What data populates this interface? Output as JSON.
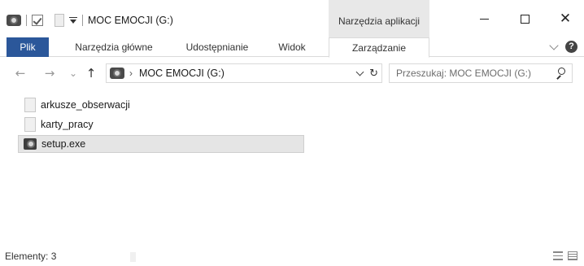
{
  "titlebar": {
    "title": "MOC EMOCJI (G:)",
    "context_tab_header": "Narzędzia aplikacji",
    "icons": [
      "drive-icon",
      "properties-check-icon",
      "new-folder-icon",
      "customize-dropdown-icon",
      "minimize-icon",
      "maximize-icon",
      "close-icon"
    ],
    "close_glyph": "✕"
  },
  "ribbon": {
    "tabs": [
      {
        "label": "Plik"
      },
      {
        "label": "Narzędzia główne"
      },
      {
        "label": "Udostępnianie"
      },
      {
        "label": "Widok"
      },
      {
        "label": "Zarządzanie"
      }
    ],
    "help_glyph": "?"
  },
  "nav": {
    "back_glyph": "←",
    "forward_glyph": "→",
    "up_glyph": "↑",
    "recent_glyph": "⌄",
    "crumb_separator": "›",
    "breadcrumb": "MOC EMOCJI (G:)",
    "refresh_glyph": "↻"
  },
  "search": {
    "placeholder": "Przeszukaj: MOC EMOCJI (G:)"
  },
  "files": [
    {
      "name": "arkusze_obserwacji",
      "type": "folder",
      "selected": false
    },
    {
      "name": "karty_pracy",
      "type": "folder",
      "selected": false
    },
    {
      "name": "setup.exe",
      "type": "application",
      "selected": true
    }
  ],
  "status": {
    "count_text": "Elementy: 3"
  },
  "colors": {
    "accent": "#2b579a",
    "selection": "#e5e5e5",
    "context_tab": "#e8e8e8"
  }
}
